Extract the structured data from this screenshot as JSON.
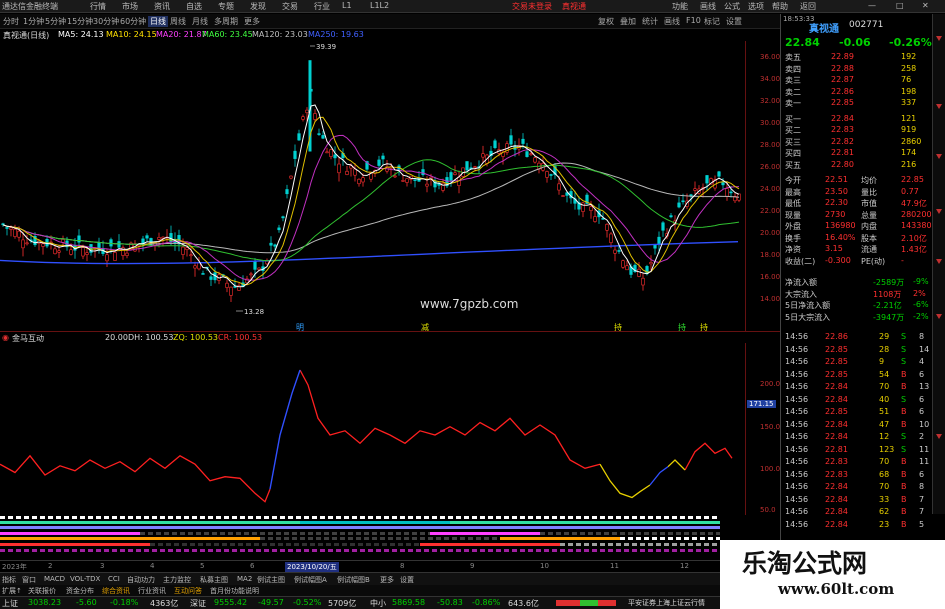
{
  "window": {
    "app_title": "通达信金融终端",
    "menu": [
      "行情",
      "市场",
      "资讯",
      "自选",
      "专题",
      "发现",
      "交易",
      "行业",
      "L1",
      "L1L2"
    ],
    "center_links": [
      "交易未登录",
      "真视通"
    ],
    "right_menu": [
      "功能",
      "画线",
      "公式",
      "选项",
      "帮助"
    ],
    "right_buttons": [
      "返回"
    ]
  },
  "period_bar": {
    "items": [
      "分时",
      "1分钟",
      "5分钟",
      "15分钟",
      "30分钟",
      "60分钟",
      "日线",
      "周线",
      "月线",
      "多周期",
      "更多"
    ],
    "active": "日线",
    "right_items": [
      "复权",
      "叠加",
      "统计",
      "画线",
      "F10",
      "标记",
      "设置"
    ]
  },
  "ma_legend": {
    "stock_label": "真视通(日线)",
    "items": [
      {
        "text": "MA5: 24.13",
        "color": "#ffffff"
      },
      {
        "text": "MA10: 24.15",
        "color": "#ffe000"
      },
      {
        "text": "MA20: 21.87",
        "color": "#ff40ff"
      },
      {
        "text": "MA60: 23.45",
        "color": "#40ff40"
      },
      {
        "text": "MA120: 23.03",
        "color": "#c0c0c0"
      },
      {
        "text": "MA250: 19.63",
        "color": "#4060ff"
      }
    ]
  },
  "main_chart": {
    "price_ticks": [
      "36.00",
      "34.00",
      "32.00",
      "30.00",
      "28.00",
      "26.00",
      "24.00",
      "22.00",
      "20.00",
      "18.00",
      "16.00",
      "14.00"
    ],
    "high_label": "39.39",
    "low_label": "13.28",
    "signals": [
      {
        "text": "明",
        "color": "#30a0ff"
      },
      {
        "text": "减",
        "color": "#e0e000"
      },
      {
        "text": "持",
        "color": "#e0e000"
      },
      {
        "text": "持",
        "color": "#30e030"
      },
      {
        "text": "持",
        "color": "#e0e000"
      }
    ]
  },
  "site_watermark": "www.7gpzb.com",
  "sub_chart": {
    "title": "金马互动",
    "info": [
      "20.00",
      "DH: 100.53",
      "ZQ: 100.53",
      "CR: 100.53"
    ],
    "ticks": [
      "200.0",
      "150.0",
      "100.0",
      "50.0"
    ],
    "current_value": "171.15"
  },
  "date_bar": {
    "labels": [
      "2023年",
      "2",
      "3",
      "4",
      "5",
      "6",
      "7",
      "8",
      "9",
      "10",
      "11",
      "12"
    ],
    "highlight": "2023/10/20/五"
  },
  "tab_bar": {
    "items": [
      "指标",
      "窗口",
      "MACD",
      "VOL-TDX",
      "CCI",
      "自动功力",
      "主力监控",
      "私募主图",
      "MA2",
      "例试主图",
      "例试幅图A",
      "例试幅图B",
      "更多",
      "设置"
    ]
  },
  "tab_bar2": {
    "items": [
      "扩展↑",
      "关联报价",
      "资金分布",
      "综合资讯",
      "行业资讯",
      "互动问答",
      "首月份功能说明"
    ]
  },
  "status_bar": {
    "indices": [
      {
        "name": "上证",
        "value": "3038.23",
        "change": "-5.60",
        "pct": "-0.18%",
        "amount": "4363亿"
      },
      {
        "name": "深证",
        "value": "9555.42",
        "change": "-49.57",
        "pct": "-0.52%",
        "amount": "5709亿"
      },
      {
        "name": "中小",
        "value": "5869.58",
        "change": "-50.83",
        "pct": "-0.86%",
        "amount": "643.6亿"
      }
    ],
    "broker": "平安证券上海上证云行情"
  },
  "quote": {
    "time": "18:53:33",
    "name": "真视通",
    "code": "002771",
    "price": "22.84",
    "change": "-0.06",
    "pct": "-0.26%",
    "asks": [
      {
        "label": "卖五",
        "price": "22.89",
        "vol": "192"
      },
      {
        "label": "卖四",
        "price": "22.88",
        "vol": "258"
      },
      {
        "label": "卖三",
        "price": "22.87",
        "vol": "76"
      },
      {
        "label": "卖二",
        "price": "22.86",
        "vol": "198"
      },
      {
        "label": "卖一",
        "price": "22.85",
        "vol": "337"
      }
    ],
    "bids": [
      {
        "label": "买一",
        "price": "22.84",
        "vol": "121"
      },
      {
        "label": "买二",
        "price": "22.83",
        "vol": "919"
      },
      {
        "label": "买三",
        "price": "22.82",
        "vol": "2860"
      },
      {
        "label": "买四",
        "price": "22.81",
        "vol": "174"
      },
      {
        "label": "买五",
        "price": "22.80",
        "vol": "216"
      }
    ],
    "stats": [
      {
        "l1": "今开",
        "v1": "22.51",
        "l2": "均价",
        "v2": "22.85"
      },
      {
        "l1": "最高",
        "v1": "23.50",
        "l2": "量比",
        "v2": "0.77"
      },
      {
        "l1": "最低",
        "v1": "22.30",
        "l2": "市值",
        "v2": "47.9亿"
      },
      {
        "l1": "现量",
        "v1": "2730",
        "l2": "总量",
        "v2": "280200"
      },
      {
        "l1": "外盘",
        "v1": "136980",
        "l2": "内盘",
        "v2": "143380"
      },
      {
        "l1": "换手",
        "v1": "16.40%",
        "l2": "股本",
        "v2": "2.10亿"
      },
      {
        "l1": "净资",
        "v1": "3.15",
        "l2": "流通",
        "v2": "1.43亿"
      },
      {
        "l1": "收益(二)",
        "v1": "-0.300",
        "l2": "PE(动)",
        "v2": "-"
      }
    ],
    "flows": [
      {
        "label": "净流入额",
        "value": "-2589万",
        "pct": "-9%"
      },
      {
        "label": "大宗流入",
        "value": "1108万",
        "pct": "2%"
      },
      {
        "label": "5日净流入额",
        "value": "-2.21亿",
        "pct": "-6%"
      },
      {
        "label": "5日大宗流入",
        "value": "-3947万",
        "pct": "-2%"
      }
    ],
    "ticks": [
      {
        "time": "14:56",
        "price": "22.86",
        "vol": "29",
        "bs": "S",
        "n": "8"
      },
      {
        "time": "14:56",
        "price": "22.85",
        "vol": "28",
        "bs": "S",
        "n": "14"
      },
      {
        "time": "14:56",
        "price": "22.85",
        "vol": "9",
        "bs": "S",
        "n": "4"
      },
      {
        "time": "14:56",
        "price": "22.85",
        "vol": "54",
        "bs": "B",
        "n": "6"
      },
      {
        "time": "14:56",
        "price": "22.84",
        "vol": "70",
        "bs": "B",
        "n": "13"
      },
      {
        "time": "14:56",
        "price": "22.84",
        "vol": "40",
        "bs": "S",
        "n": "6"
      },
      {
        "time": "14:56",
        "price": "22.85",
        "vol": "51",
        "bs": "B",
        "n": "6"
      },
      {
        "time": "14:56",
        "price": "22.84",
        "vol": "47",
        "bs": "B",
        "n": "10"
      },
      {
        "time": "14:56",
        "price": "22.84",
        "vol": "12",
        "bs": "S",
        "n": "2"
      },
      {
        "time": "14:56",
        "price": "22.81",
        "vol": "123",
        "bs": "S",
        "n": "11"
      },
      {
        "time": "14:56",
        "price": "22.83",
        "vol": "70",
        "bs": "B",
        "n": "11"
      },
      {
        "time": "14:56",
        "price": "22.83",
        "vol": "68",
        "bs": "B",
        "n": "6"
      },
      {
        "time": "14:56",
        "price": "22.84",
        "vol": "70",
        "bs": "B",
        "n": "8"
      },
      {
        "time": "14:56",
        "price": "22.84",
        "vol": "33",
        "bs": "B",
        "n": "7"
      },
      {
        "time": "14:56",
        "price": "22.84",
        "vol": "62",
        "bs": "B",
        "n": "7"
      },
      {
        "time": "14:56",
        "price": "22.84",
        "vol": "23",
        "bs": "B",
        "n": "5"
      }
    ]
  },
  "watermark": {
    "line1": "乐淘公式网",
    "line2": "www.60lt.com"
  },
  "colors": {
    "up": "#ff3030",
    "down": "#00d0d0",
    "axis": "#c03030",
    "ma250": "#3050ff",
    "sub_line": "#ff2020"
  }
}
